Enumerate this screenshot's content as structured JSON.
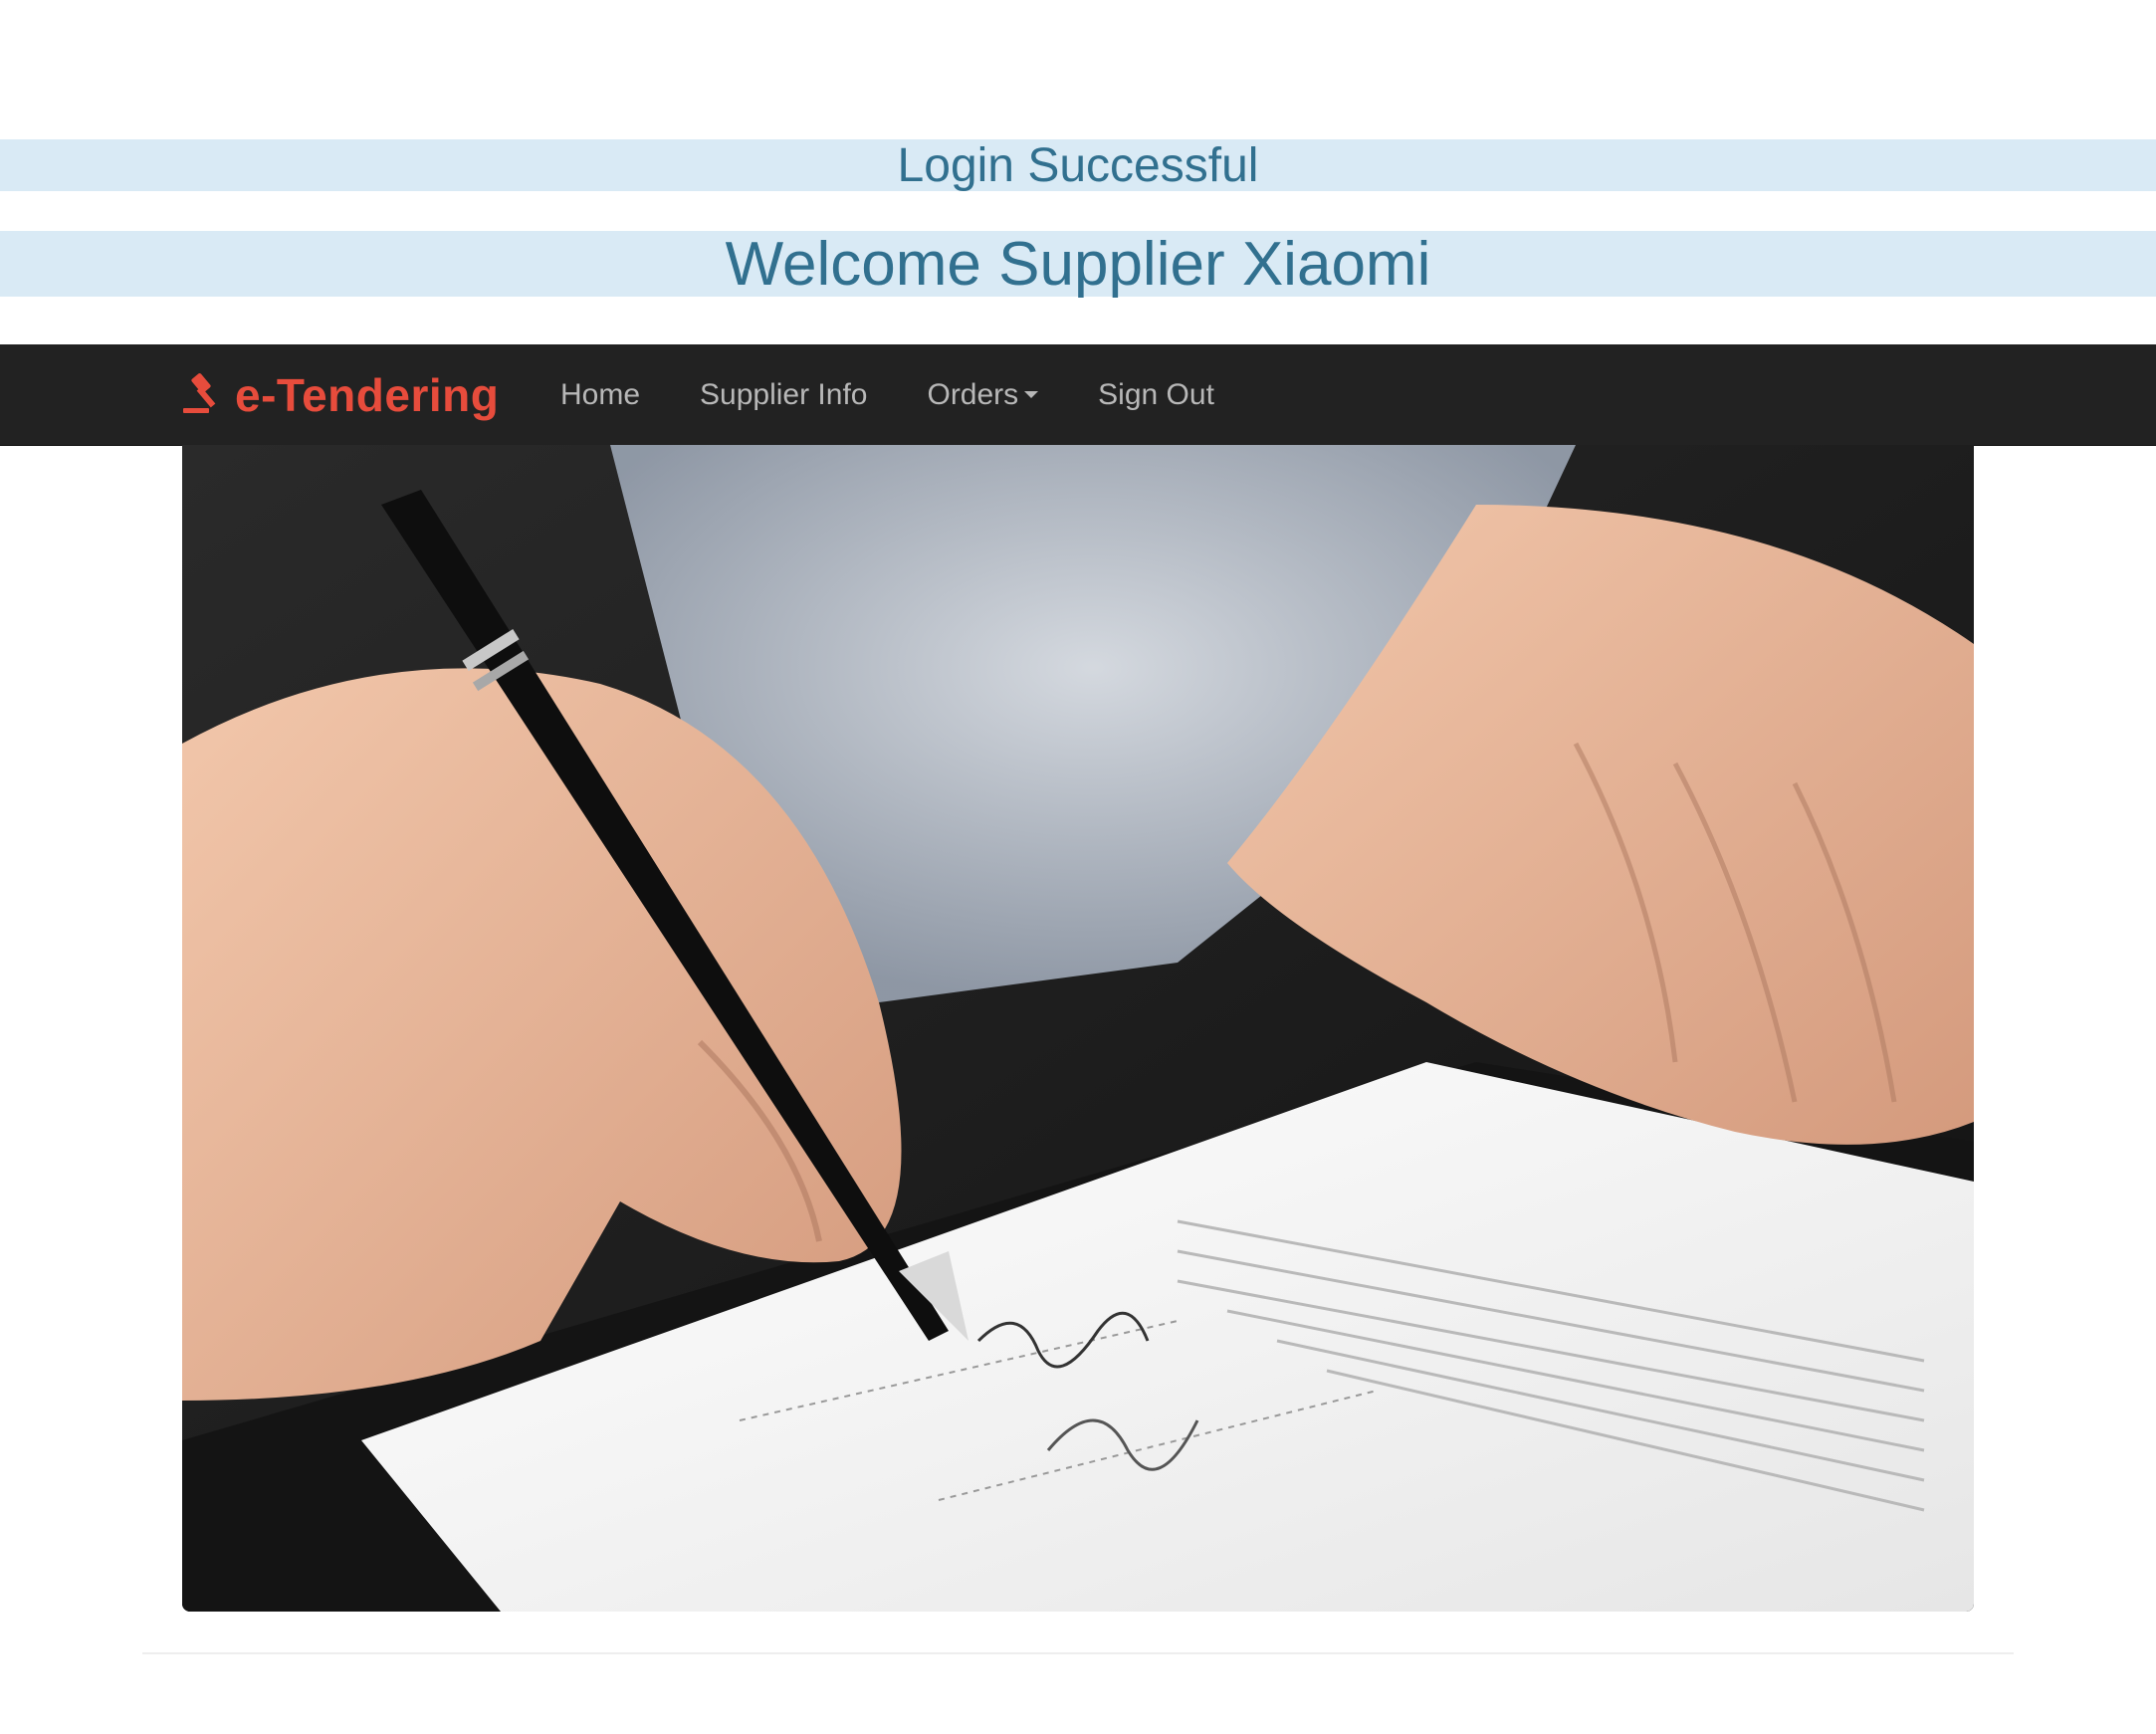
{
  "messages": {
    "login_status": "Login Successful",
    "welcome": "Welcome Supplier Xiaomi"
  },
  "navbar": {
    "brand": "e-Tendering",
    "brand_icon": "gavel-icon",
    "brand_color": "#e74c3c",
    "background": "#222222",
    "items": [
      {
        "label": "Home"
      },
      {
        "label": "Supplier Info"
      },
      {
        "label": "Orders",
        "dropdown": true
      },
      {
        "label": "Sign Out"
      }
    ]
  },
  "hero": {
    "image": "photo of a hand signing a document with a pen"
  },
  "colors": {
    "banner_background": "#d9eaf5",
    "banner_text": "#31708f"
  }
}
